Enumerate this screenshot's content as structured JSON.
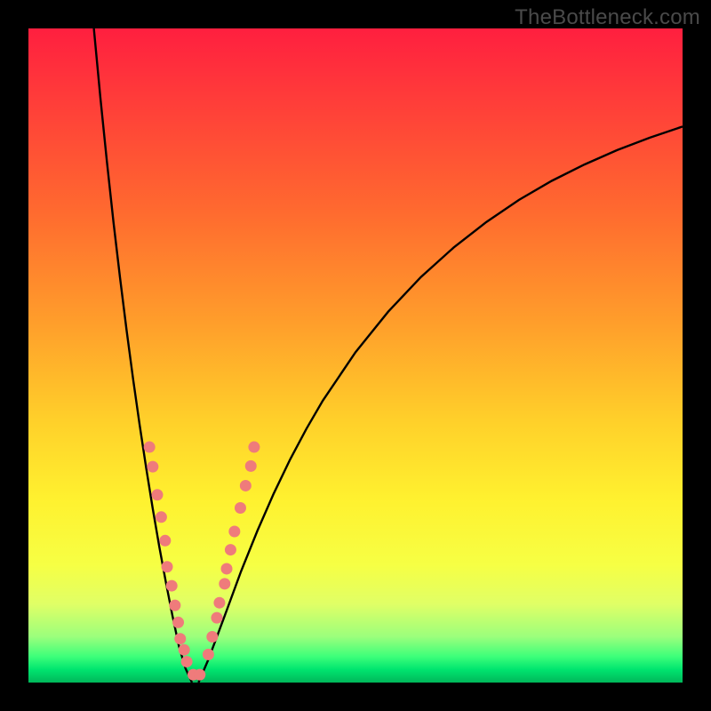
{
  "watermark": "TheBottleneck.com",
  "colors": {
    "gradient_top": "#ff1f3f",
    "gradient_mid1": "#ff9e2b",
    "gradient_mid2": "#fff12f",
    "gradient_bottom": "#00b75a",
    "curve": "#000000",
    "marker": "#ef7b7b",
    "frame": "#000000",
    "watermark_text": "#4a4a4a"
  },
  "chart_data": {
    "type": "line",
    "title": "",
    "xlabel": "",
    "ylabel": "",
    "xlim": [
      0,
      100
    ],
    "ylim": [
      0,
      100
    ],
    "grid": false,
    "legend": false,
    "series": [
      {
        "name": "curve-left",
        "x": [
          10.0,
          11.0,
          12.0,
          13.0,
          14.0,
          15.0,
          16.0,
          17.0,
          18.0,
          19.0,
          20.0,
          21.0,
          22.0,
          23.0,
          24.0,
          25.0
        ],
        "y": [
          100.0,
          89.4,
          79.6,
          70.4,
          61.9,
          53.9,
          46.4,
          39.4,
          32.8,
          26.6,
          20.8,
          15.4,
          10.3,
          5.6,
          2.2,
          0.0
        ]
      },
      {
        "name": "curve-right",
        "x": [
          26.0,
          27.5,
          30.0,
          32.5,
          35.0,
          37.5,
          40.0,
          42.5,
          45.0,
          50.0,
          55.0,
          60.0,
          65.0,
          70.0,
          75.0,
          80.0,
          85.0,
          90.0,
          95.0,
          100.0
        ],
        "y": [
          0.0,
          3.5,
          10.2,
          17.0,
          23.2,
          28.9,
          34.1,
          38.8,
          43.1,
          50.5,
          56.7,
          62.0,
          66.5,
          70.4,
          73.8,
          76.7,
          79.2,
          81.4,
          83.3,
          85.0
        ]
      }
    ],
    "markers": [
      {
        "x": 18.5,
        "y": 36.0
      },
      {
        "x": 19.0,
        "y": 33.0
      },
      {
        "x": 19.7,
        "y": 28.7
      },
      {
        "x": 20.3,
        "y": 25.3
      },
      {
        "x": 20.9,
        "y": 21.7
      },
      {
        "x": 21.2,
        "y": 17.7
      },
      {
        "x": 21.9,
        "y": 14.8
      },
      {
        "x": 22.4,
        "y": 11.8
      },
      {
        "x": 22.9,
        "y": 9.2
      },
      {
        "x": 23.2,
        "y": 6.7
      },
      {
        "x": 23.8,
        "y": 5.0
      },
      {
        "x": 24.2,
        "y": 3.2
      },
      {
        "x": 25.2,
        "y": 1.2
      },
      {
        "x": 26.2,
        "y": 1.2
      },
      {
        "x": 27.5,
        "y": 4.3
      },
      {
        "x": 28.1,
        "y": 7.0
      },
      {
        "x": 28.8,
        "y": 9.9
      },
      {
        "x": 29.2,
        "y": 12.2
      },
      {
        "x": 30.0,
        "y": 15.1
      },
      {
        "x": 30.3,
        "y": 17.4
      },
      {
        "x": 30.9,
        "y": 20.3
      },
      {
        "x": 31.5,
        "y": 23.1
      },
      {
        "x": 32.4,
        "y": 26.7
      },
      {
        "x": 33.2,
        "y": 30.1
      },
      {
        "x": 34.0,
        "y": 33.1
      },
      {
        "x": 34.5,
        "y": 36.0
      }
    ]
  }
}
